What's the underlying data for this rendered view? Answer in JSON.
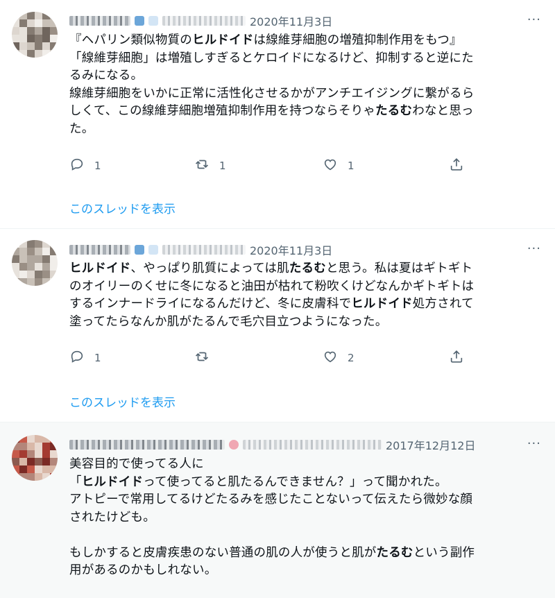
{
  "tweets": [
    {
      "date": "2020年11月3日",
      "lines": [
        [
          {
            "t": "『ヘパリン類似物質の"
          },
          {
            "t": "ヒルドイド",
            "b": true
          },
          {
            "t": "は線維芽細胞の増殖抑制作用をもつ』"
          }
        ],
        [
          {
            "t": "「線維芽細胞」は増殖しすぎるとケロイドになるけど、抑制すると逆にた"
          }
        ],
        [
          {
            "t": "るみになる。"
          }
        ],
        [
          {
            "t": "線維芽細胞をいかに正常に活性化させるかがアンチエイジングに繋がるら"
          }
        ],
        [
          {
            "t": "しくて、この線維芽細胞増殖抑制作用を持つならそりゃ"
          },
          {
            "t": "たるむ",
            "b": true
          },
          {
            "t": "わなと思っ"
          }
        ],
        [
          {
            "t": "た。"
          }
        ]
      ],
      "reply_count": "1",
      "retweet_count": "1",
      "like_count": "1",
      "show_thread": "このスレッドを表示"
    },
    {
      "date": "2020年11月3日",
      "lines": [
        [
          {
            "t": "ヒルドイド",
            "b": true
          },
          {
            "t": "、やっぱり肌質によっては肌"
          },
          {
            "t": "たるむ",
            "b": true
          },
          {
            "t": "と思う。私は夏はギトギト"
          }
        ],
        [
          {
            "t": "のオイリーのくせに冬になると油田が枯れて粉吹くけどなんかギトギトは"
          }
        ],
        [
          {
            "t": "するインナードライになるんだけど、冬に皮膚科で"
          },
          {
            "t": "ヒルドイド",
            "b": true
          },
          {
            "t": "処方されて"
          }
        ],
        [
          {
            "t": "塗ってたらなんか肌がたるんで毛穴目立つようになった。"
          }
        ]
      ],
      "reply_count": "1",
      "retweet_count": "",
      "like_count": "2",
      "show_thread": "このスレッドを表示"
    },
    {
      "date": "2017年12月12日",
      "lines": [
        [
          {
            "t": "美容目的で使ってる人に"
          }
        ],
        [
          {
            "t": "「"
          },
          {
            "t": "ヒルドイド",
            "b": true
          },
          {
            "t": "って使ってると肌たるんできません？」って聞かれた。"
          }
        ],
        [
          {
            "t": "アトピーで常用してるけどたるみを感じたことないって伝えたら微妙な顔"
          }
        ],
        [
          {
            "t": "されたけども。"
          }
        ],
        [
          {
            "t": ""
          }
        ],
        [
          {
            "t": "もしかすると皮膚疾患のない普通の肌の人が使うと肌が"
          },
          {
            "t": "たるむ",
            "b": true
          },
          {
            "t": "という副作"
          }
        ],
        [
          {
            "t": "用があるのかもしれない。"
          }
        ]
      ]
    }
  ],
  "more_label": "···",
  "icons": {
    "reply": "reply-icon",
    "retweet": "retweet-icon",
    "like": "heart-icon",
    "share": "share-icon"
  },
  "colors": {
    "link": "#1d9bf0",
    "muted": "#536471",
    "text": "#0f1419",
    "highlight_bg": "#f7f9f9"
  }
}
